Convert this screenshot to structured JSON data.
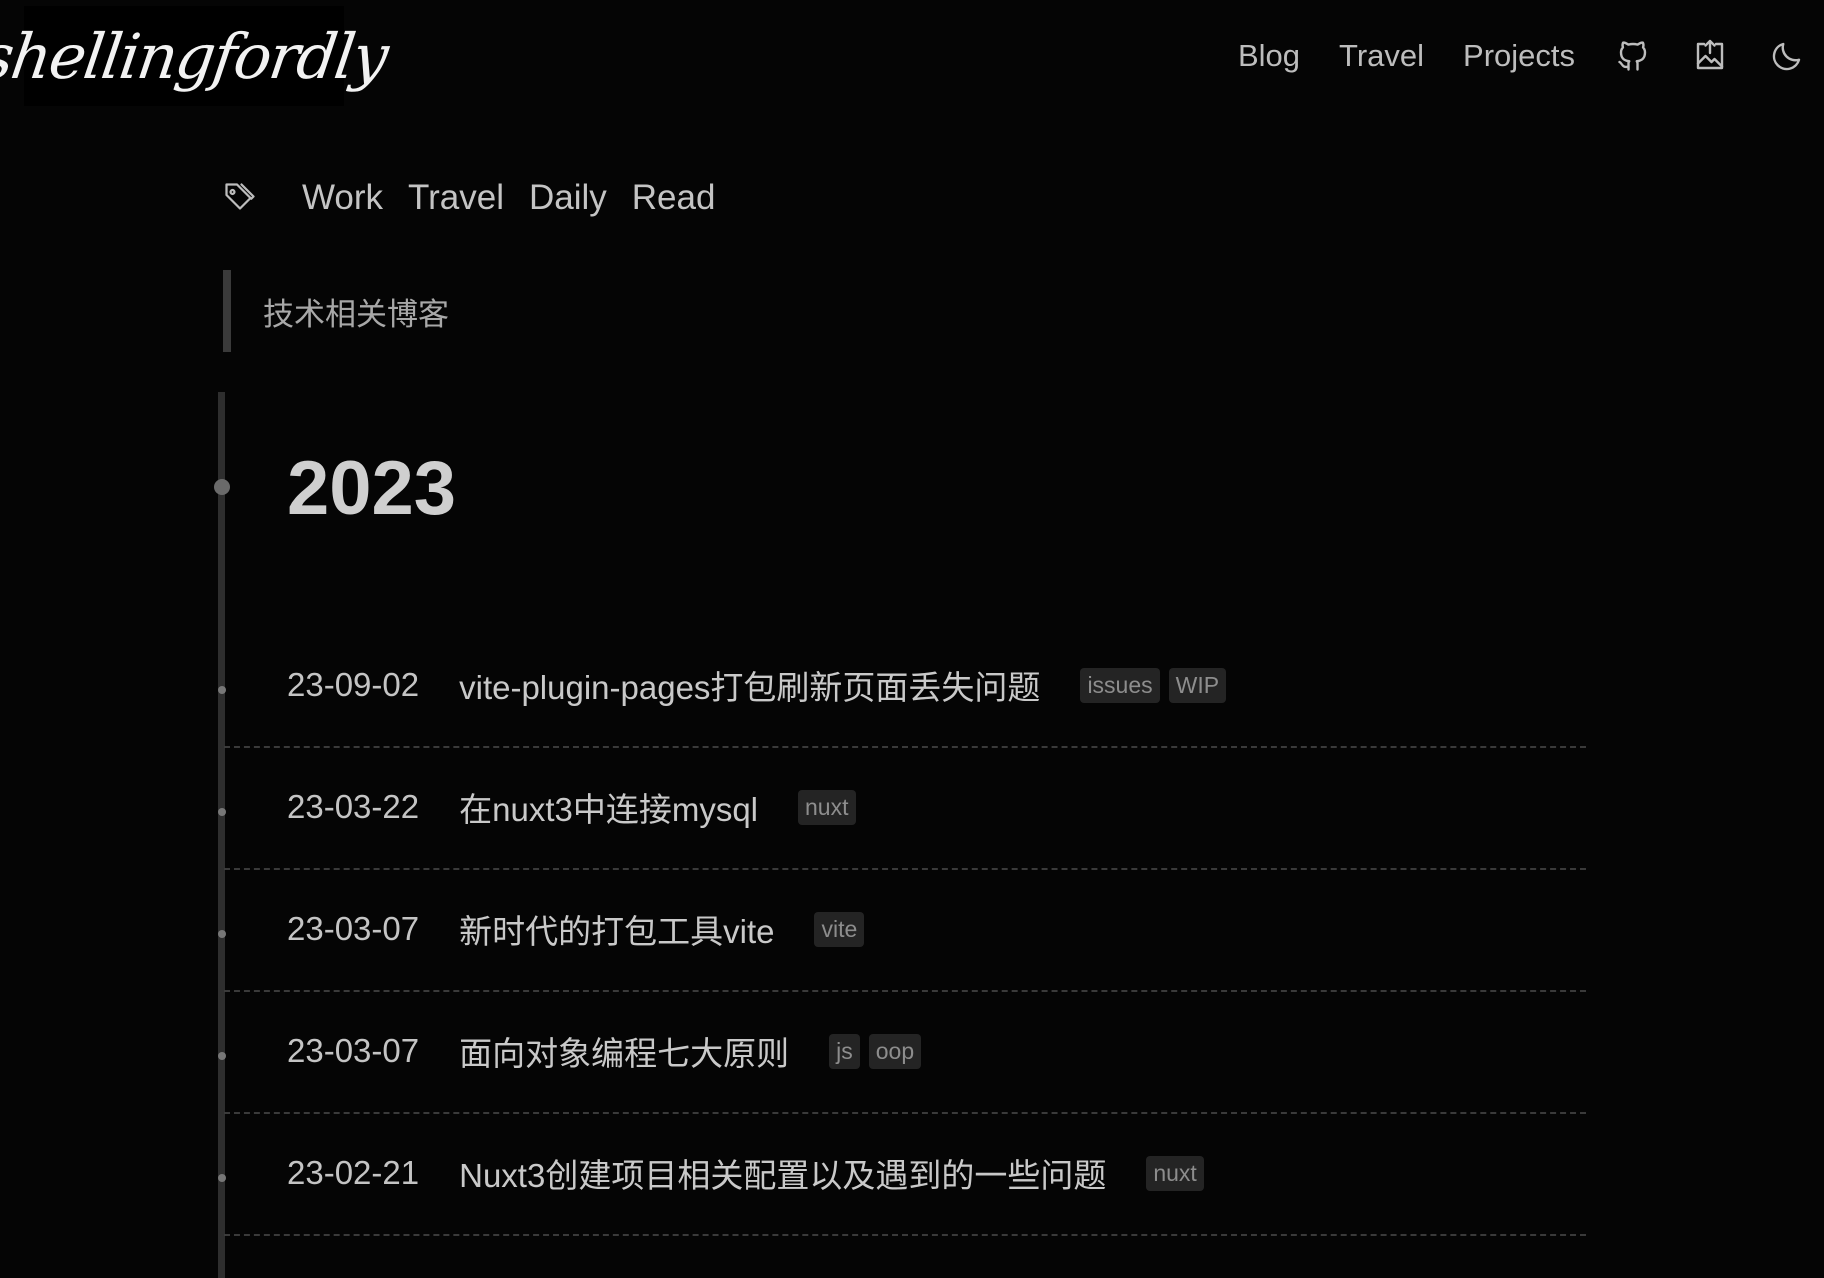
{
  "header": {
    "logo_text": "shellingfordly",
    "nav": [
      "Blog",
      "Travel",
      "Projects"
    ],
    "icons": [
      "github-icon",
      "photos-icon",
      "dark-mode-moon-icon"
    ]
  },
  "tags": {
    "icon": "tag-icon",
    "items": [
      "Work",
      "Travel",
      "Daily",
      "Read"
    ]
  },
  "description": "技术相关博客",
  "year": "2023",
  "posts": [
    {
      "date": "23-09-02",
      "title": "vite-plugin-pages打包刷新页面丢失问题",
      "tags": [
        "issues",
        "WIP"
      ]
    },
    {
      "date": "23-03-22",
      "title": "在nuxt3中连接mysql",
      "tags": [
        "nuxt"
      ]
    },
    {
      "date": "23-03-07",
      "title": "新时代的打包工具vite",
      "tags": [
        "vite"
      ]
    },
    {
      "date": "23-03-07",
      "title": "面向对象编程七大原则",
      "tags": [
        "js",
        "oop"
      ]
    },
    {
      "date": "23-02-21",
      "title": "Nuxt3创建项目相关配置以及遇到的一些问题",
      "tags": [
        "nuxt"
      ]
    }
  ],
  "colors": {
    "background": "#050505",
    "text": "#c4c4c4",
    "badge_bg": "#242424",
    "timeline": "#2e2e2e"
  }
}
